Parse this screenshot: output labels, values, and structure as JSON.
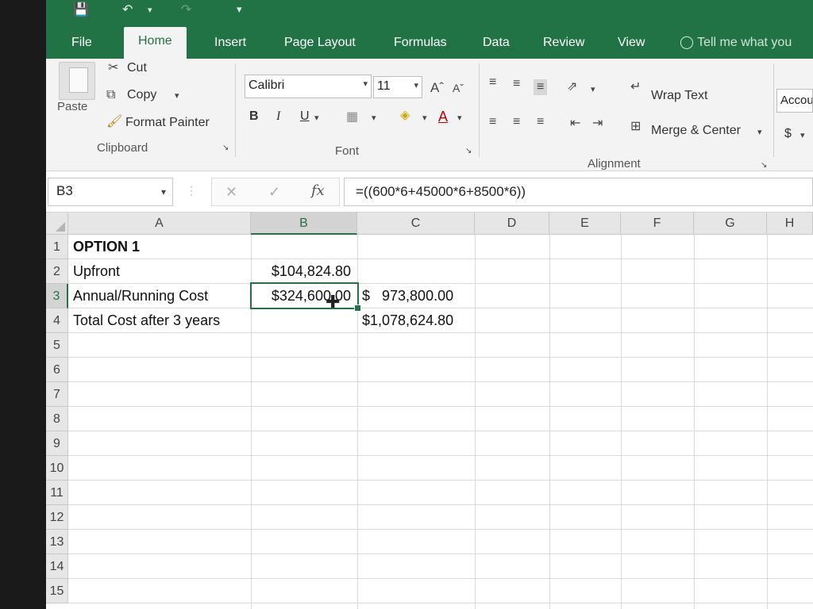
{
  "tabs": [
    {
      "label": "File"
    },
    {
      "label": "Home"
    },
    {
      "label": "Insert"
    },
    {
      "label": "Page Layout"
    },
    {
      "label": "Formulas"
    },
    {
      "label": "Data"
    },
    {
      "label": "Review"
    },
    {
      "label": "View"
    }
  ],
  "tell_me": "Tell me what you wa",
  "clipboard": {
    "paste": "Paste",
    "cut": "Cut",
    "copy": "Copy",
    "format_painter": "Format Painter",
    "group_label": "Clipboard"
  },
  "font": {
    "name": "Calibri",
    "size": "11",
    "bold": "B",
    "italic": "I",
    "underline": "U",
    "group_label": "Font"
  },
  "alignment": {
    "wrap_text": "Wrap Text",
    "merge_center": "Merge & Center",
    "group_label": "Alignment"
  },
  "number": {
    "format": "Accou",
    "currency": "$"
  },
  "formula_bar": {
    "name_box": "B3",
    "fx": "fx",
    "formula": "=((600*6+45000*6+8500*6))"
  },
  "columns": [
    "A",
    "B",
    "C",
    "D",
    "E",
    "F",
    "G",
    "H"
  ],
  "rows": [
    "1",
    "2",
    "3",
    "4",
    "5",
    "6",
    "7",
    "8",
    "9",
    "10",
    "11",
    "12",
    "13",
    "14",
    "15"
  ],
  "cells": {
    "A1": "OPTION 1",
    "A2": "Upfront",
    "A3": "Annual/Running Cost",
    "A4": "Total Cost after 3 years",
    "B2": "$104,824.80",
    "B3": "$324,600.00",
    "C3": "$   973,800.00",
    "C4": "$1,078,624.80"
  },
  "colors": {
    "accent": "#217346"
  }
}
